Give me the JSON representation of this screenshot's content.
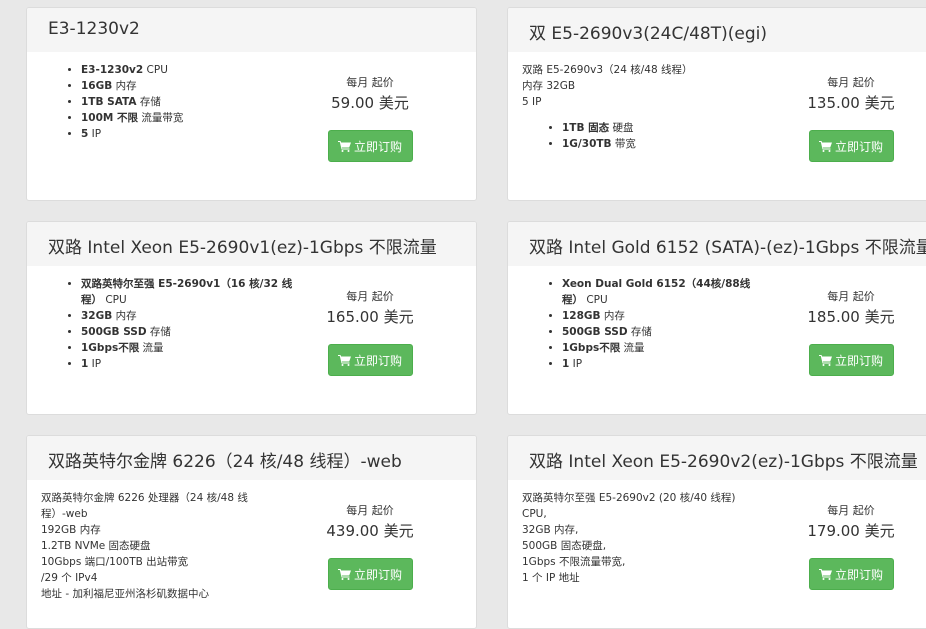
{
  "cards": [
    {
      "title": "E3-1230v2",
      "specs": [
        {
          "b": "E3-1230v2",
          "t": " CPU"
        },
        {
          "b": "16GB",
          "t": " 内存"
        },
        {
          "b": "1TB SATA",
          "t": " 存储"
        },
        {
          "b": "100M 不限",
          "t": " 流量带宽"
        },
        {
          "b": "5",
          "t": " IP"
        }
      ],
      "price_label": "每月 起价",
      "price": "59.00 美元",
      "button": "立即订购"
    },
    {
      "title": "双 E5-2690v3(24C/48T)(egi)",
      "plain": [
        "双路 E5-2690v3（24 核/48 线程）",
        "内存 32GB",
        "5 IP"
      ],
      "specs": [
        {
          "b": "1TB 固态",
          "t": " 硬盘"
        },
        {
          "b": "1G/30TB",
          "t": " 带宽"
        }
      ],
      "price_label": "每月 起价",
      "price": "135.00 美元",
      "button": "立即订购"
    },
    {
      "title": "双路 Intel Xeon E5-2690v1(ez)-1Gbps 不限流量",
      "specs": [
        {
          "b": "双路英特尔至强 E5-2690v1（16 核/32 线程）",
          "t": "  CPU"
        },
        {
          "b": "32GB",
          "t": " 内存"
        },
        {
          "b": "500GB SSD",
          "t": " 存储"
        },
        {
          "b": "1Gbps不限",
          "t": " 流量"
        },
        {
          "b": "1",
          "t": " IP"
        }
      ],
      "price_label": "每月 起价",
      "price": "165.00 美元",
      "button": "立即订购"
    },
    {
      "title": "双路 Intel Gold 6152 (SATA)-(ez)-1Gbps 不限流量",
      "specs": [
        {
          "b": "Xeon Dual Gold 6152（44核/88线程）",
          "t": "  CPU"
        },
        {
          "b": "128GB",
          "t": " 内存"
        },
        {
          "b": "500GB SSD",
          "t": " 存储"
        },
        {
          "b": "1Gbps不限",
          "t": " 流量"
        },
        {
          "b": "1",
          "t": " IP"
        }
      ],
      "price_label": "每月 起价",
      "price": "185.00 美元",
      "button": "立即订购"
    },
    {
      "title": "双路英特尔金牌 6226（24 核/48 线程）-web",
      "plain": [
        "双路英特尔金牌 6226 处理器（24 核/48 线",
        "程）-web",
        "192GB 内存",
        "1.2TB NVMe 固态硬盘",
        "10Gbps 端口/100TB 出站带宽",
        "/29 个 IPv4",
        "地址 - 加利福尼亚州洛杉矶数据中心"
      ],
      "price_label": "每月 起价",
      "price": "439.00 美元",
      "button": "立即订购"
    },
    {
      "title": "双路 Intel Xeon E5-2690v2(ez)-1Gbps 不限流量",
      "plain": [
        "双路英特尔至强 E5-2690v2 (20 核/40 线程)",
        "CPU,",
        "32GB 内存,",
        "500GB 固态硬盘,",
        "1Gbps 不限流量带宽,",
        "1 个 IP 地址"
      ],
      "price_label": "每月 起价",
      "price": "179.00 美元",
      "button": "立即订购"
    }
  ]
}
